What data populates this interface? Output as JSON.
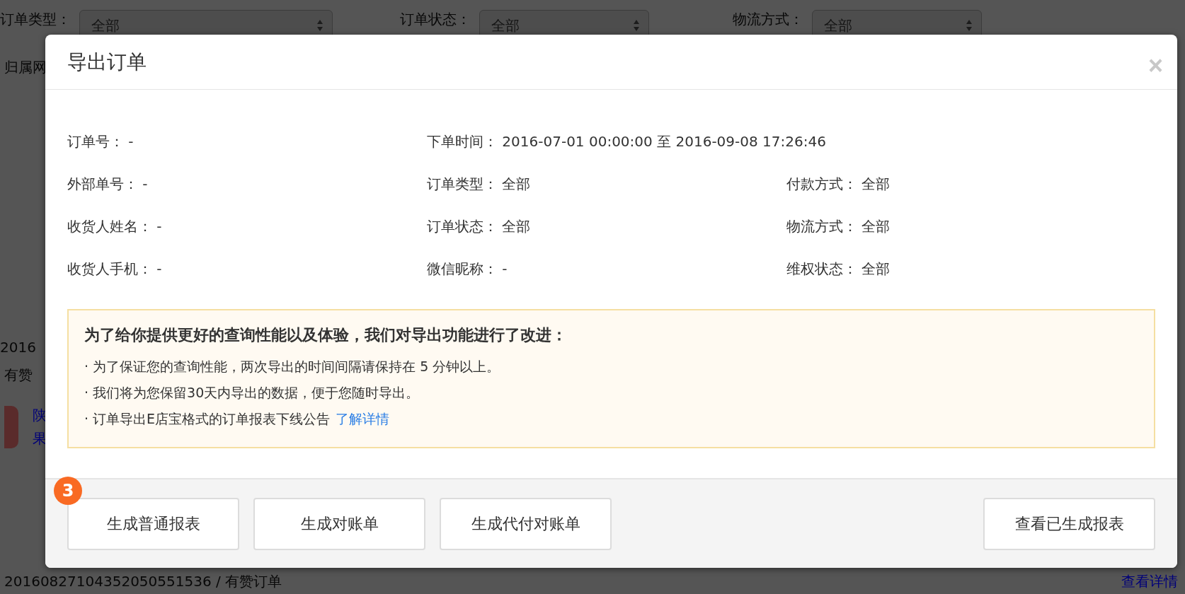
{
  "background": {
    "filters": [
      {
        "label": "订单类型：",
        "value": "全部"
      },
      {
        "label": "订单状态：",
        "value": "全部"
      },
      {
        "label": "物流方式：",
        "value": "全部"
      }
    ],
    "second_row_label": "归属网",
    "order": {
      "number": "2016",
      "shop": "有赞",
      "product_lines": [
        "陕",
        "果"
      ]
    },
    "bottom_order": {
      "number": "20160827104352050551536 / 有赞订单",
      "link": "查看详情"
    }
  },
  "dialog": {
    "title": "导出订单",
    "close": "×",
    "field_rows": [
      [
        {
          "label": "订单号：",
          "value": "-"
        },
        {
          "label": "下单时间：",
          "value": "2016-07-01 00:00:00 至 2016-09-08 17:26:46"
        }
      ],
      [
        {
          "label": "外部单号：",
          "value": "-"
        },
        {
          "label": "订单类型：",
          "value": "全部"
        },
        {
          "label": "付款方式：",
          "value": "全部"
        }
      ],
      [
        {
          "label": "收货人姓名：",
          "value": "-"
        },
        {
          "label": "订单状态：",
          "value": "全部"
        },
        {
          "label": "物流方式：",
          "value": "全部"
        }
      ],
      [
        {
          "label": "收货人手机：",
          "value": "-"
        },
        {
          "label": "微信昵称：",
          "value": "-"
        },
        {
          "label": "维权状态：",
          "value": "全部"
        }
      ]
    ],
    "notice": {
      "title": "为了给你提供更好的查询性能以及体验，我们对导出功能进行了改进：",
      "items": [
        {
          "bullet": "·",
          "text": "为了保证您的查询性能，两次导出的时间间隔请保持在 5 分钟以上。"
        },
        {
          "bullet": "·",
          "text": "我们将为您保留30天内导出的数据，便于您随时导出。"
        },
        {
          "bullet": "·",
          "text": "订单导出E店宝格式的订单报表下线公告",
          "link": "了解详情"
        }
      ]
    },
    "badge": "3",
    "left_buttons": [
      "生成普通报表",
      "生成对账单",
      "生成代付对账单"
    ],
    "right_buttons": [
      "查看已生成报表"
    ]
  }
}
